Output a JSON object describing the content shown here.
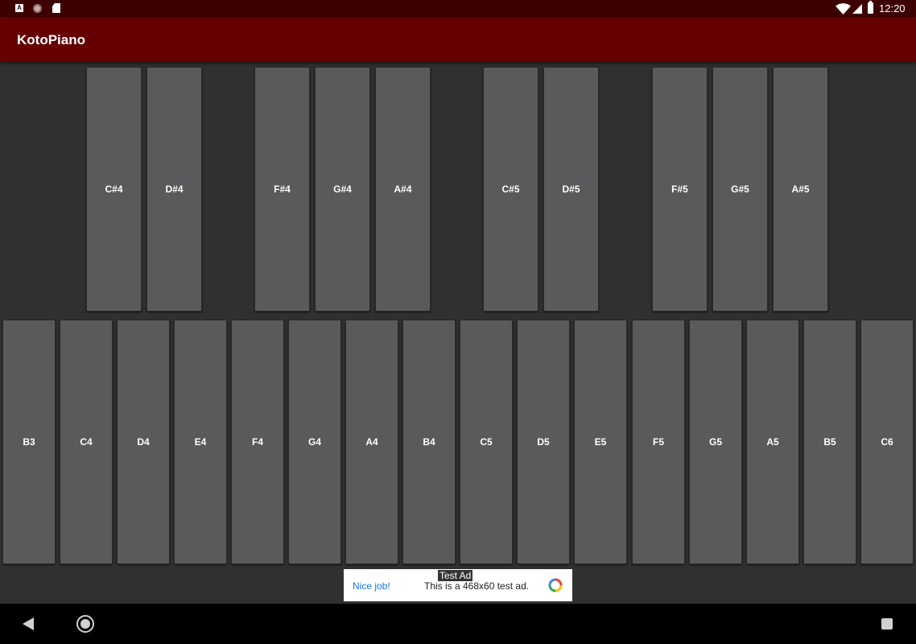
{
  "status_bar": {
    "notification_a_label": "A",
    "time": "12:20",
    "icons": [
      "a-notification-icon",
      "circle-notification-icon",
      "sd-card-icon",
      "wifi-icon",
      "signal-icon",
      "battery-icon"
    ]
  },
  "app_bar": {
    "title": "KotoPiano",
    "color": "#660000"
  },
  "keyboard": {
    "black_keys": [
      "C#4",
      "D#4",
      "F#4",
      "G#4",
      "A#4",
      "C#5",
      "D#5",
      "F#5",
      "G#5",
      "A#5"
    ],
    "white_keys": [
      "B3",
      "C4",
      "D4",
      "E4",
      "F4",
      "G4",
      "A4",
      "B4",
      "C5",
      "D5",
      "E5",
      "F5",
      "G5",
      "A5",
      "B5",
      "C6"
    ],
    "key_color": "#5a5a5c"
  },
  "ad": {
    "tag": "Test Ad",
    "headline": "Nice job!",
    "body": "This is a 468x60 test ad."
  },
  "nav_bar": {
    "icons": [
      "back-icon",
      "home-icon",
      "recents-icon"
    ]
  }
}
